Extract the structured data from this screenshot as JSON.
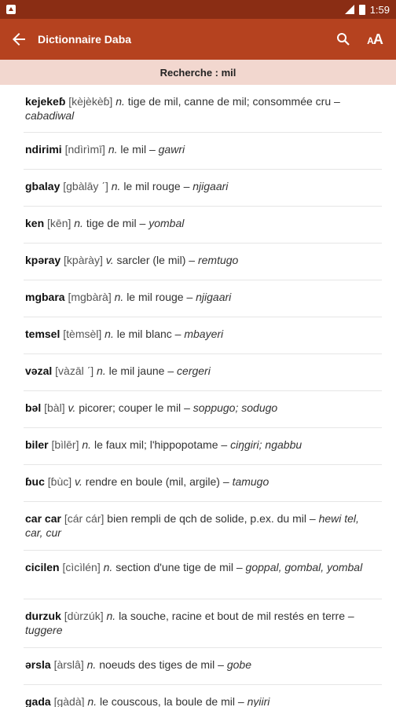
{
  "status_bar": {
    "time": "1:59"
  },
  "app_bar": {
    "title": "Dictionnaire Daba",
    "font_size_label_big": "A",
    "font_size_label_small": "A"
  },
  "search": {
    "label": "Recherche : mil"
  },
  "entries": [
    {
      "headword": "kejekeɓ",
      "phon": "[kèjèkèɓ]",
      "pos": "n.",
      "def": "tige de mil, canne de mil; consommée cru",
      "sep": "–",
      "trans": "cabadiwal"
    },
    {
      "headword": "ndirimi",
      "phon": "[ndìrìmī]",
      "pos": "n.",
      "def": "le mil",
      "sep": "–",
      "trans": "gawri"
    },
    {
      "headword": "gbalay",
      "phon": "[gbàlāy ˊ]",
      "pos": "n.",
      "def": "le mil rouge",
      "sep": "–",
      "trans": "njigaari"
    },
    {
      "headword": "ken",
      "phon": "[kēn]",
      "pos": "n.",
      "def": "tige de mil",
      "sep": "–",
      "trans": "yombal"
    },
    {
      "headword": "kpəray",
      "phon": "[kpàrày]",
      "pos": "v.",
      "def": "sarcler (le mil)",
      "sep": "–",
      "trans": "remtugo"
    },
    {
      "headword": "mgbara",
      "phon": "[mgbàrà]",
      "pos": "n.",
      "def": "le mil rouge",
      "sep": "–",
      "trans": "njigaari"
    },
    {
      "headword": "temsel",
      "phon": "[tèmsèl]",
      "pos": "n.",
      "def": "le mil blanc",
      "sep": "–",
      "trans": "mbayeri"
    },
    {
      "headword": "vəzal",
      "phon": "[vàzāl ˊ]",
      "pos": "n.",
      "def": "le mil jaune",
      "sep": "–",
      "trans": "cergeri"
    },
    {
      "headword": "bəl",
      "phon": "[bàl]",
      "pos": "v.",
      "def": "picorer; couper le mil",
      "sep": "–",
      "trans": "soppugo; sodugo"
    },
    {
      "headword": "biler",
      "phon": "[bìlēr]",
      "pos": "n.",
      "def": "le faux mil; l'hippopotame",
      "sep": "–",
      "trans": "ciŋgiri; ngabbu"
    },
    {
      "headword": "ɓuc",
      "phon": "[ɓùc]",
      "pos": "v.",
      "def": "rendre en boule (mil, argile)",
      "sep": "–",
      "trans": "tamugo"
    },
    {
      "headword": "car car",
      "phon": "[cár cár]",
      "pos": "",
      "def": "bien rempli de qch de solide, p.ex. du mil",
      "sep": "–",
      "trans": "hewi tel, car, cur"
    },
    {
      "headword": "cicilen",
      "phon": "[cìcìlén]",
      "pos": "n.",
      "def": "section d'une tige de mil",
      "sep": "–",
      "trans": "goppal, gombal, yombal"
    },
    {
      "headword": "durzuk",
      "phon": "[dùrzúk]",
      "pos": "n.",
      "def": "la souche, racine et bout de mil restés en terre",
      "sep": "–",
      "trans": "tuggere"
    },
    {
      "headword": "ərsla",
      "phon": "[àrslâ]",
      "pos": "n.",
      "def": "noeuds des tiges de mil",
      "sep": "–",
      "trans": "gobe"
    },
    {
      "headword": "gada",
      "phon": "[gàdà]",
      "pos": "n.",
      "def": "le couscous, la boule de mil",
      "sep": "–",
      "trans": "nyiiri"
    }
  ]
}
